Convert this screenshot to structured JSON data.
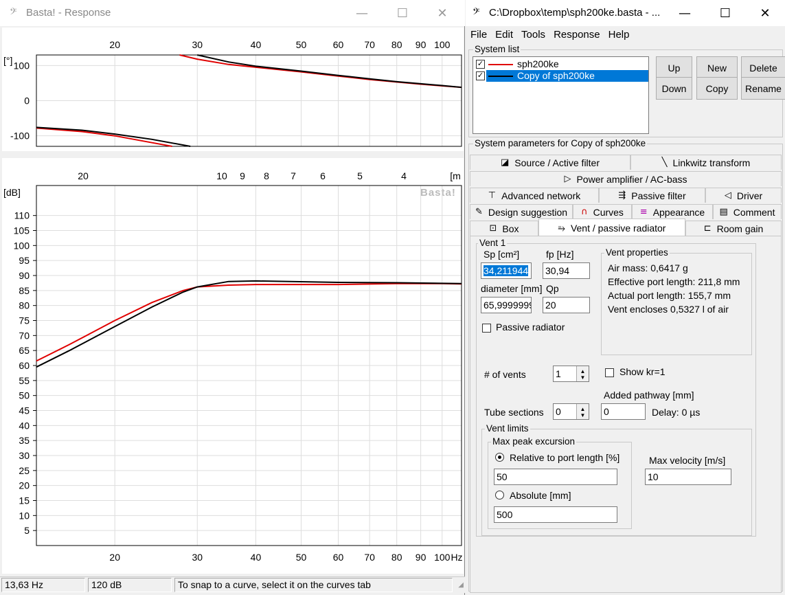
{
  "left_window": {
    "title": "Basta! - Response",
    "status": {
      "freq": "13,63 Hz",
      "level": "120 dB",
      "hint": "To snap to a curve, select it on the curves tab"
    }
  },
  "phase_plot": {
    "y_unit": "[°]",
    "y_ticks": [
      "100",
      "0",
      "-100"
    ],
    "x_ticks": [
      "20",
      "30",
      "40",
      "50",
      "60",
      "70",
      "80",
      "90",
      "100"
    ]
  },
  "spl_plot": {
    "y_unit": "[dB]",
    "watermark": "Basta!",
    "y_ticks": [
      "110",
      "105",
      "100",
      "95",
      "90",
      "85",
      "80",
      "75",
      "70",
      "65",
      "60",
      "55",
      "50",
      "45",
      "40",
      "35",
      "30",
      "25",
      "20",
      "15",
      "10",
      "5"
    ],
    "x_ticks_bottom": [
      "20",
      "30",
      "40",
      "50",
      "60",
      "70",
      "80",
      "90",
      "100",
      "Hz"
    ],
    "x_ticks_top": [
      "20",
      "10",
      "9",
      "8",
      "7",
      "6",
      "5",
      "4",
      "[m"
    ]
  },
  "chart_data": [
    {
      "type": "line",
      "xlabel": "",
      "ylabel": "[°]",
      "xscale": "log",
      "xlim": [
        13.6,
        110
      ],
      "ylim": [
        -130,
        130
      ],
      "series": [
        {
          "name": "sph200ke",
          "color": "#e00000",
          "x": [
            13.6,
            17,
            20,
            23,
            26.5,
            27.5,
            30,
            35,
            40,
            50,
            60,
            70,
            80,
            90,
            100,
            110
          ],
          "y": [
            -78,
            -88,
            -100,
            -115,
            -130,
            130,
            118,
            103,
            95,
            82,
            70,
            60,
            53,
            47,
            42,
            38
          ]
        },
        {
          "name": "Copy of sph200ke",
          "color": "#000000",
          "x": [
            13.6,
            17,
            20,
            24,
            29,
            30,
            35,
            40,
            50,
            60,
            70,
            80,
            90,
            100,
            110
          ],
          "y": [
            -76,
            -84,
            -95,
            -110,
            -130,
            130,
            110,
            98,
            84,
            72,
            62,
            54,
            48,
            43,
            38
          ]
        }
      ]
    },
    {
      "type": "line",
      "xlabel": "Hz",
      "ylabel": "[dB]",
      "xscale": "log",
      "xlim": [
        13.6,
        110
      ],
      "ylim": [
        0,
        110
      ],
      "series": [
        {
          "name": "sph200ke",
          "color": "#e00000",
          "x": [
            13.6,
            16,
            20,
            24,
            28,
            30,
            35,
            40,
            60,
            80,
            100,
            110
          ],
          "y": [
            61.5,
            67,
            75,
            81,
            85,
            86.2,
            86.8,
            87,
            87,
            87.3,
            87.3,
            87.2
          ]
        },
        {
          "name": "Copy of sph200ke",
          "color": "#000000",
          "x": [
            13.6,
            16,
            20,
            24,
            28,
            30,
            35,
            40,
            60,
            80,
            100,
            110
          ],
          "y": [
            59.5,
            65,
            73,
            79.5,
            84.5,
            86.2,
            88,
            88.2,
            87.7,
            87.6,
            87.4,
            87.3
          ]
        }
      ]
    }
  ],
  "right_window": {
    "title": "C:\\Dropbox\\temp\\sph200ke.basta - ...",
    "menu": [
      "File",
      "Edit",
      "Tools",
      "Response",
      "Help"
    ],
    "system_list_label": "System list",
    "systems": [
      {
        "name": "sph200ke",
        "color": "#e00000",
        "checked": true,
        "selected": false
      },
      {
        "name": "Copy of sph200ke",
        "color": "#000000",
        "checked": true,
        "selected": true
      }
    ],
    "buttons": {
      "up": "Up",
      "new": "New",
      "delete": "Delete",
      "down": "Down",
      "copy": "Copy",
      "rename": "Rename"
    },
    "params_label": "System parameters for Copy of sph200ke",
    "tabs": {
      "source": "Source / Active filter",
      "linkwitz": "Linkwitz transform",
      "power": "Power amplifier / AC-bass",
      "advanced": "Advanced network",
      "passive": "Passive filter",
      "driver": "Driver",
      "design": "Design suggestion",
      "curves": "Curves",
      "appearance": "Appearance",
      "comment": "Comment",
      "box": "Box",
      "vent": "Vent / passive radiator",
      "room": "Room gain"
    },
    "vent": {
      "group": "Vent 1",
      "sp_label": "Sp [cm²]",
      "sp_value": "34,211944",
      "fp_label": "fp [Hz]",
      "fp_value": "30,94",
      "diam_label": "diameter [mm]",
      "diam_value": "65,9999999",
      "qp_label": "Qp",
      "qp_value": "20",
      "passive_radiator": "Passive radiator",
      "props_label": "Vent properties",
      "air_mass": "Air mass: 0,6417 g",
      "eff_len": "Effective port length: 211,8 mm",
      "act_len": "Actual port length: 155,7 mm",
      "encloses": "Vent encloses 0,5327 l of air",
      "vents_label": "# of vents",
      "vents_value": "1",
      "show_kr": "Show kr=1",
      "added_label": "Added pathway [mm]",
      "added_value": "0",
      "tube_label": "Tube sections",
      "tube_value": "0",
      "delay": "Delay: 0 µs",
      "limits_label": "Vent limits",
      "max_exc_label": "Max peak excursion",
      "relative_label": "Relative to port length [%]",
      "relative_value": "50",
      "absolute_label": "Absolute [mm]",
      "absolute_value": "500",
      "max_vel_label": "Max velocity [m/s]",
      "max_vel_value": "10"
    }
  }
}
